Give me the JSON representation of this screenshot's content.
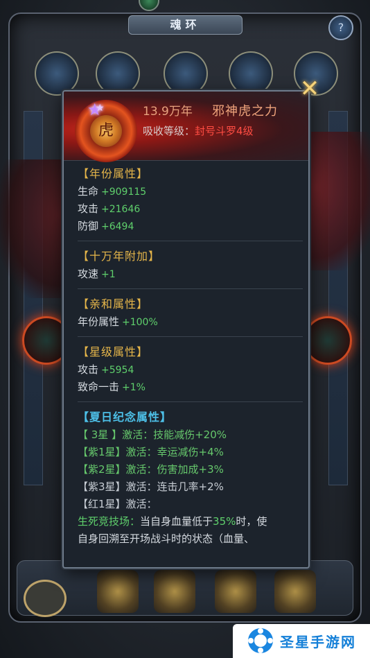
{
  "background": {
    "title": "魂环"
  },
  "popup": {
    "header": {
      "year": "13.9万年",
      "name": "邪神虎之力",
      "absorb_label": "吸收等级：",
      "absorb_value": "封号斗罗4级",
      "star_icon": "purple-star-icon"
    },
    "sections": {
      "year_attr": {
        "title": "【年份属性】",
        "rows": [
          {
            "label": "生命",
            "value": "+909115"
          },
          {
            "label": "攻击",
            "value": "+21646"
          },
          {
            "label": "防御",
            "value": "+6494"
          }
        ]
      },
      "hundred_k": {
        "title": "【十万年附加】",
        "rows": [
          {
            "label": "攻速",
            "value": "+1"
          }
        ]
      },
      "affinity": {
        "title": "【亲和属性】",
        "rows": [
          {
            "label": "年份属性",
            "value": "+100%"
          }
        ]
      },
      "star": {
        "title": "【星级属性】",
        "rows": [
          {
            "label": "攻击",
            "value": "+5954"
          },
          {
            "label": "致命一击",
            "value": "+1%"
          }
        ]
      },
      "summer": {
        "title": "【夏日纪念属性】",
        "rows": [
          {
            "tag": "【 3星 】",
            "text": "激活：技能减伤+20%"
          },
          {
            "tag": "【紫1星】",
            "text": "激活：幸运减伤+4%"
          },
          {
            "tag": "【紫2星】",
            "text": "激活：伤害加成+3%"
          },
          {
            "tag": "【紫3星】",
            "text": "激活：连击几率+2%"
          },
          {
            "tag": "【红1星】",
            "text": "激活："
          }
        ],
        "desc_line1_a": "生死竞技场：",
        "desc_line1_b": "当自身血量低于",
        "desc_line1_c": "35%",
        "desc_line1_d": "时，使",
        "desc_line2": "自身回溯至开场战斗时的状态（血量、"
      }
    }
  },
  "watermark": {
    "text": "圣星手游网"
  },
  "colors": {
    "gold_title": "#e6b64a",
    "green_value": "#5fd06c",
    "red_value": "#ff4d43",
    "cyan_title": "#4dc0e8"
  }
}
